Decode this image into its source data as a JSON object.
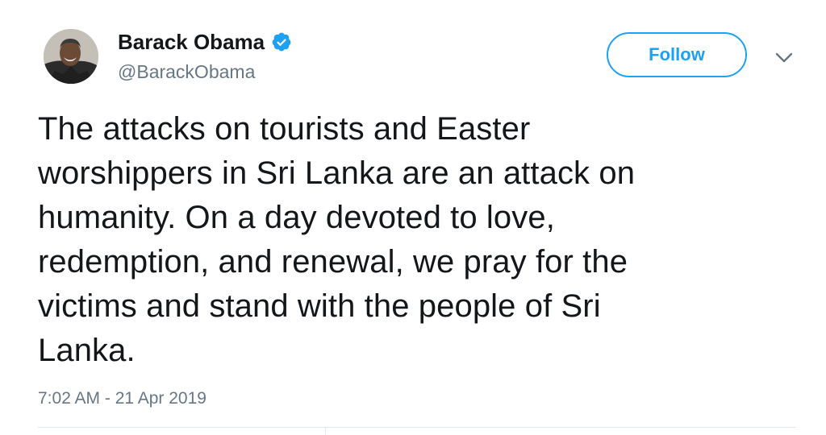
{
  "author": {
    "name": "Barack Obama",
    "handle": "@BarackObama",
    "verified": true
  },
  "actions": {
    "follow_label": "Follow",
    "more_icon": "chevron-down-icon"
  },
  "tweet": {
    "text_lines": [
      "The attacks on tourists and Easter",
      "worshippers in Sri Lanka are an attack on",
      "humanity. On a day devoted to love,",
      "redemption, and renewal, we pray for the",
      "victims and stand with the people of Sri",
      "Lanka."
    ],
    "timestamp": "7:02 AM - 21 Apr 2019"
  },
  "colors": {
    "accent": "#1da1f2",
    "text_primary": "#14171a",
    "text_secondary": "#657786",
    "divider": "#e1e8ed"
  }
}
